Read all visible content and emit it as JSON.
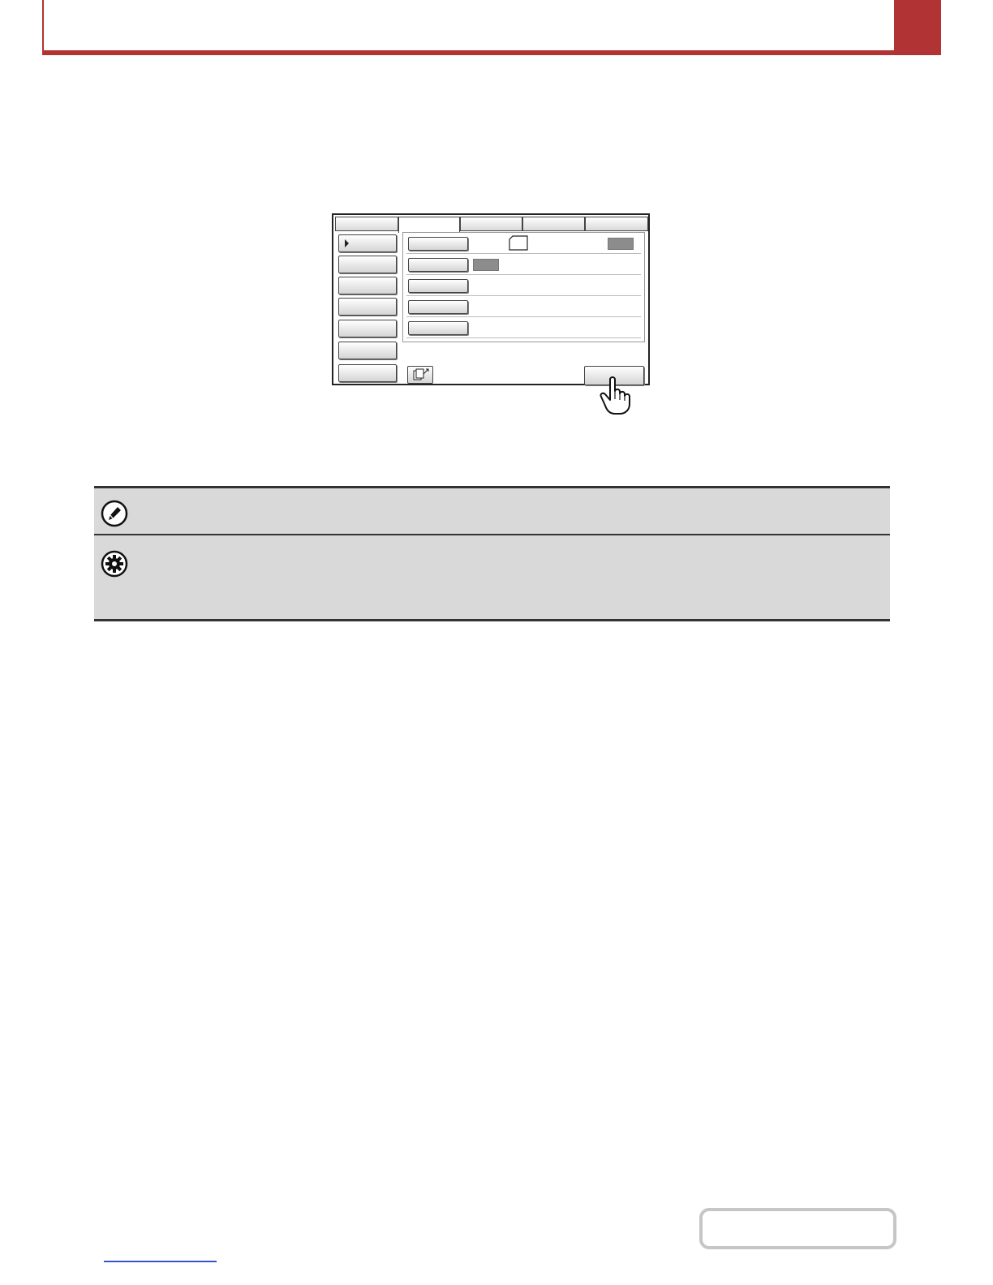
{
  "header": {
    "accent_color": "#b23333",
    "page_tab_label": ""
  },
  "panel": {
    "tabs": [
      "",
      "",
      "",
      "",
      ""
    ],
    "active_tab_index": 1,
    "side_buttons": [
      "",
      "",
      "",
      "",
      "",
      "",
      ""
    ],
    "rows": [
      {
        "button_label": "",
        "value": "",
        "has_paper_icon": true,
        "has_gray_box": true
      },
      {
        "button_label": "",
        "value": "",
        "has_paper_icon": false,
        "has_gray_box": true
      },
      {
        "button_label": "",
        "value": "",
        "has_paper_icon": false,
        "has_gray_box": false
      },
      {
        "button_label": "",
        "value": "",
        "has_paper_icon": false,
        "has_gray_box": false
      },
      {
        "button_label": "",
        "value": "",
        "has_paper_icon": false,
        "has_gray_box": false
      }
    ],
    "ok_label": "",
    "icons": {
      "selected_arrow": "triangle-right-icon",
      "bottom": "document-preview-icon",
      "pointer": "hand-pointer-icon"
    }
  },
  "notes": {
    "note_icon": "pencil-icon",
    "note_text": "",
    "settings_icon": "gear-icon",
    "settings_text": ""
  },
  "footer": {
    "contents_label": "",
    "link_text": ""
  }
}
